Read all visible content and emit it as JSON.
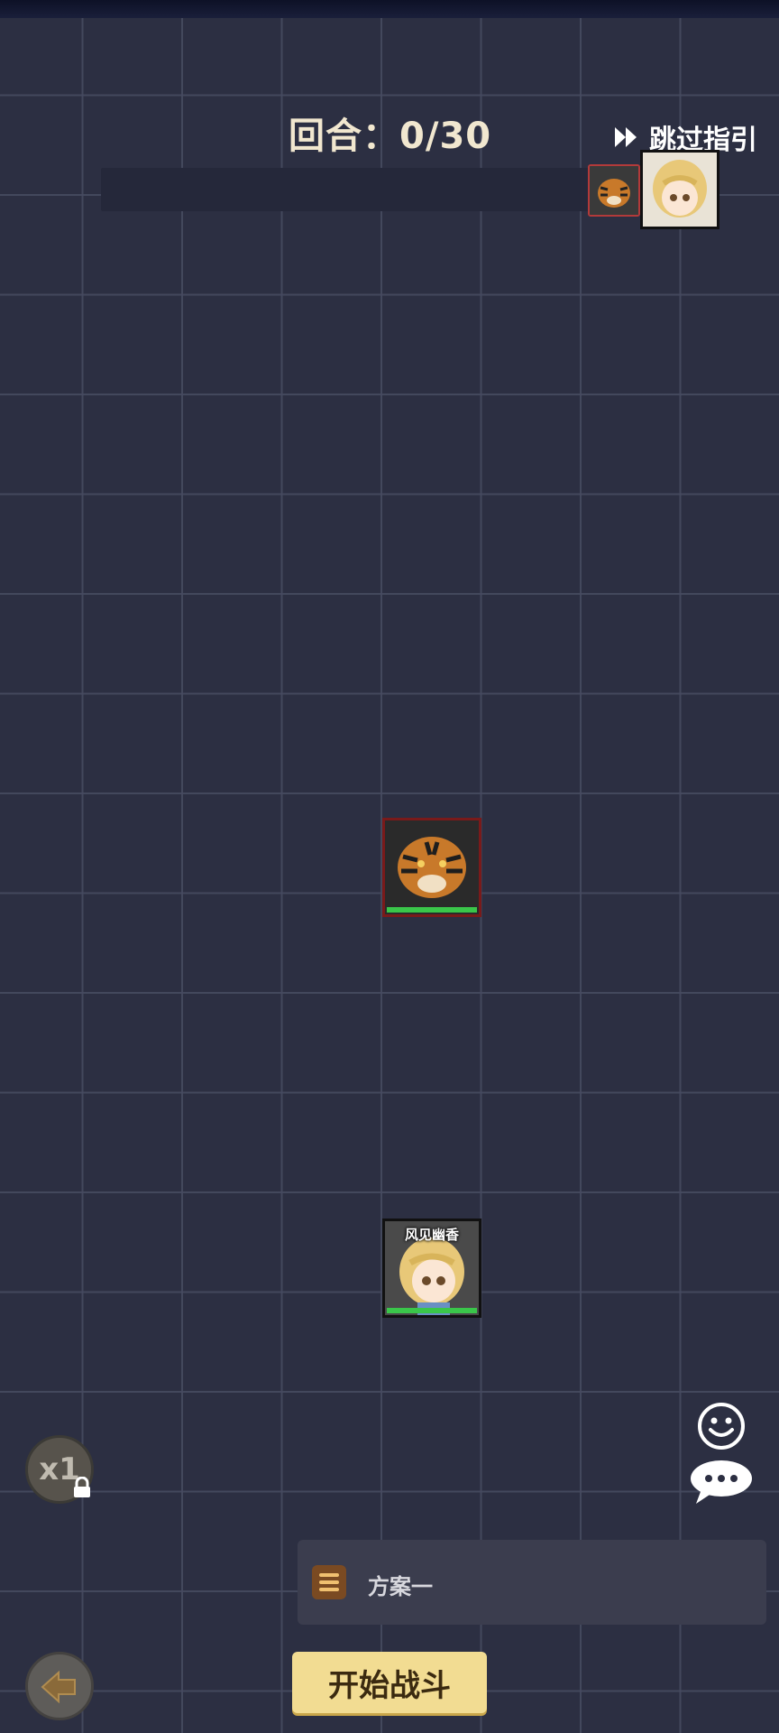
{
  "hud": {
    "round_text": "回合：0/30",
    "skip_label": "跳过指引"
  },
  "units": {
    "ally_name": "风见幽香"
  },
  "controls": {
    "speed_label": "x1",
    "plan_label": "方案一",
    "start_label": "开始战斗"
  },
  "colors": {
    "board": "#2c2f42",
    "grid_line": "#464a60",
    "enemy_border": "#7a1a1a",
    "hp_bar": "#3ac64a",
    "start_button": "#f2dc92"
  }
}
